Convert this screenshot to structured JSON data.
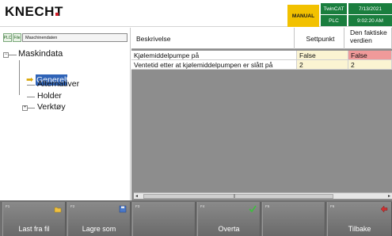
{
  "header": {
    "logo_text": "KNECHT",
    "mode": "MANUAL",
    "status": {
      "runtime": "TwinCAT",
      "plc": "PLC",
      "date": "7/13/2021",
      "time": "9:02:20 AM"
    },
    "colors": {
      "mode_bg": "#f2c100",
      "status_bg": "#1a7e3e",
      "brand_accent": "#d0202a"
    }
  },
  "left_panel": {
    "tags": [
      "PLC",
      "File"
    ],
    "path": "Maschinendaten",
    "tree": {
      "root": "Maskindata",
      "items": [
        "Generelt",
        "Alternativer",
        "Holder",
        "Verktøy"
      ],
      "selected": "Generelt"
    }
  },
  "table": {
    "headers": [
      "Beskrivelse",
      "Settpunkt",
      "Den faktiske verdien"
    ],
    "rows": [
      {
        "description": "Kjølemiddelpumpe på",
        "setpoint": "False",
        "actual": "False"
      },
      {
        "description": "Ventetid etter at kjølemiddelpumpen er slått på",
        "setpoint": "2",
        "actual": "2"
      }
    ],
    "colors": {
      "setpoint_bg": "#fbf4d2",
      "actual_bg_alert": "#f09a9a",
      "actual_bg_normal": "#fbf4d2"
    }
  },
  "function_keys": [
    {
      "key": "F1",
      "label": "Last fra fil",
      "icon": "folder-icon"
    },
    {
      "key": "F2",
      "label": "Lagre som",
      "icon": "save-icon"
    },
    {
      "key": "F3",
      "label": "",
      "icon": ""
    },
    {
      "key": "F4",
      "label": "Overta",
      "icon": "checkmark-icon"
    },
    {
      "key": "F5",
      "label": "",
      "icon": ""
    },
    {
      "key": "F6",
      "label": "Tilbake",
      "icon": "back-arrow-icon"
    }
  ]
}
